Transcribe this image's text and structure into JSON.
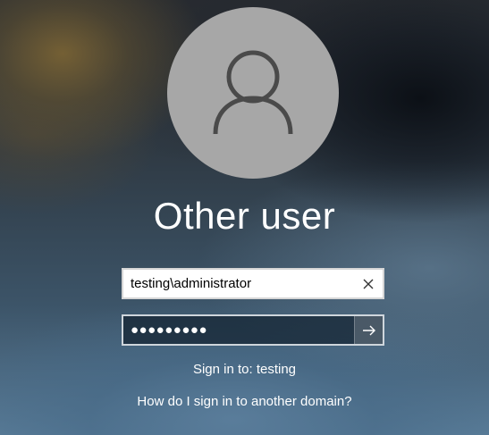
{
  "title": "Other user",
  "username_field": {
    "value": "testing\\administrator",
    "clear_icon": "close-icon"
  },
  "password_field": {
    "masked_value": "●●●●●●●●●",
    "submit_icon": "arrow-right-icon"
  },
  "sign_in_to": "Sign in to: testing",
  "domain_help_link": "How do I sign in to another domain?",
  "avatar_icon": "user-icon",
  "colors": {
    "avatar_bg": "#a7a7a7",
    "avatar_glyph": "#4a4a4a",
    "text": "#ffffff"
  }
}
